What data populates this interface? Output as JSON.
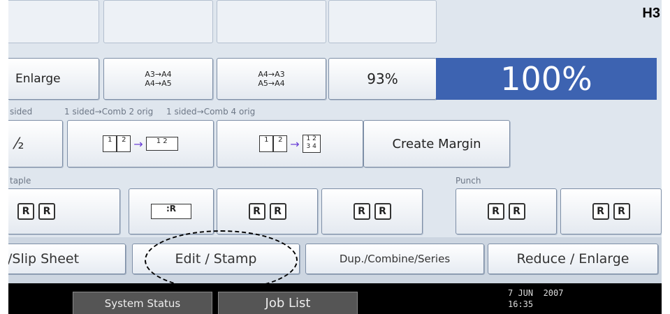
{
  "document_label": "H3",
  "ratio_buttons": {
    "enlarge": "Enlarge",
    "a3_a4": "A3→A4\nA4→A5",
    "a4_a3": "A4→A3\nA5→A4",
    "custom": "93%",
    "current_ratio": "100%"
  },
  "combine_section": {
    "label_1sided": "sided",
    "label_comb2": "1 sided→Comb 2 orig",
    "label_comb4": "1 sided→Comb 4 orig",
    "create_margin": "Create Margin"
  },
  "staple_section": {
    "label": "taple"
  },
  "punch_section": {
    "label": "Punch"
  },
  "tabs": {
    "slip_sheet": "/Slip Sheet",
    "edit_stamp": "Edit / Stamp",
    "dup_combine_series": "Dup./Combine/Series",
    "reduce_enlarge": "Reduce / Enlarge"
  },
  "status_bar": {
    "system_status": "System Status",
    "job_list": "Job List",
    "date": "7 JUN  2007",
    "time": "16:35"
  }
}
